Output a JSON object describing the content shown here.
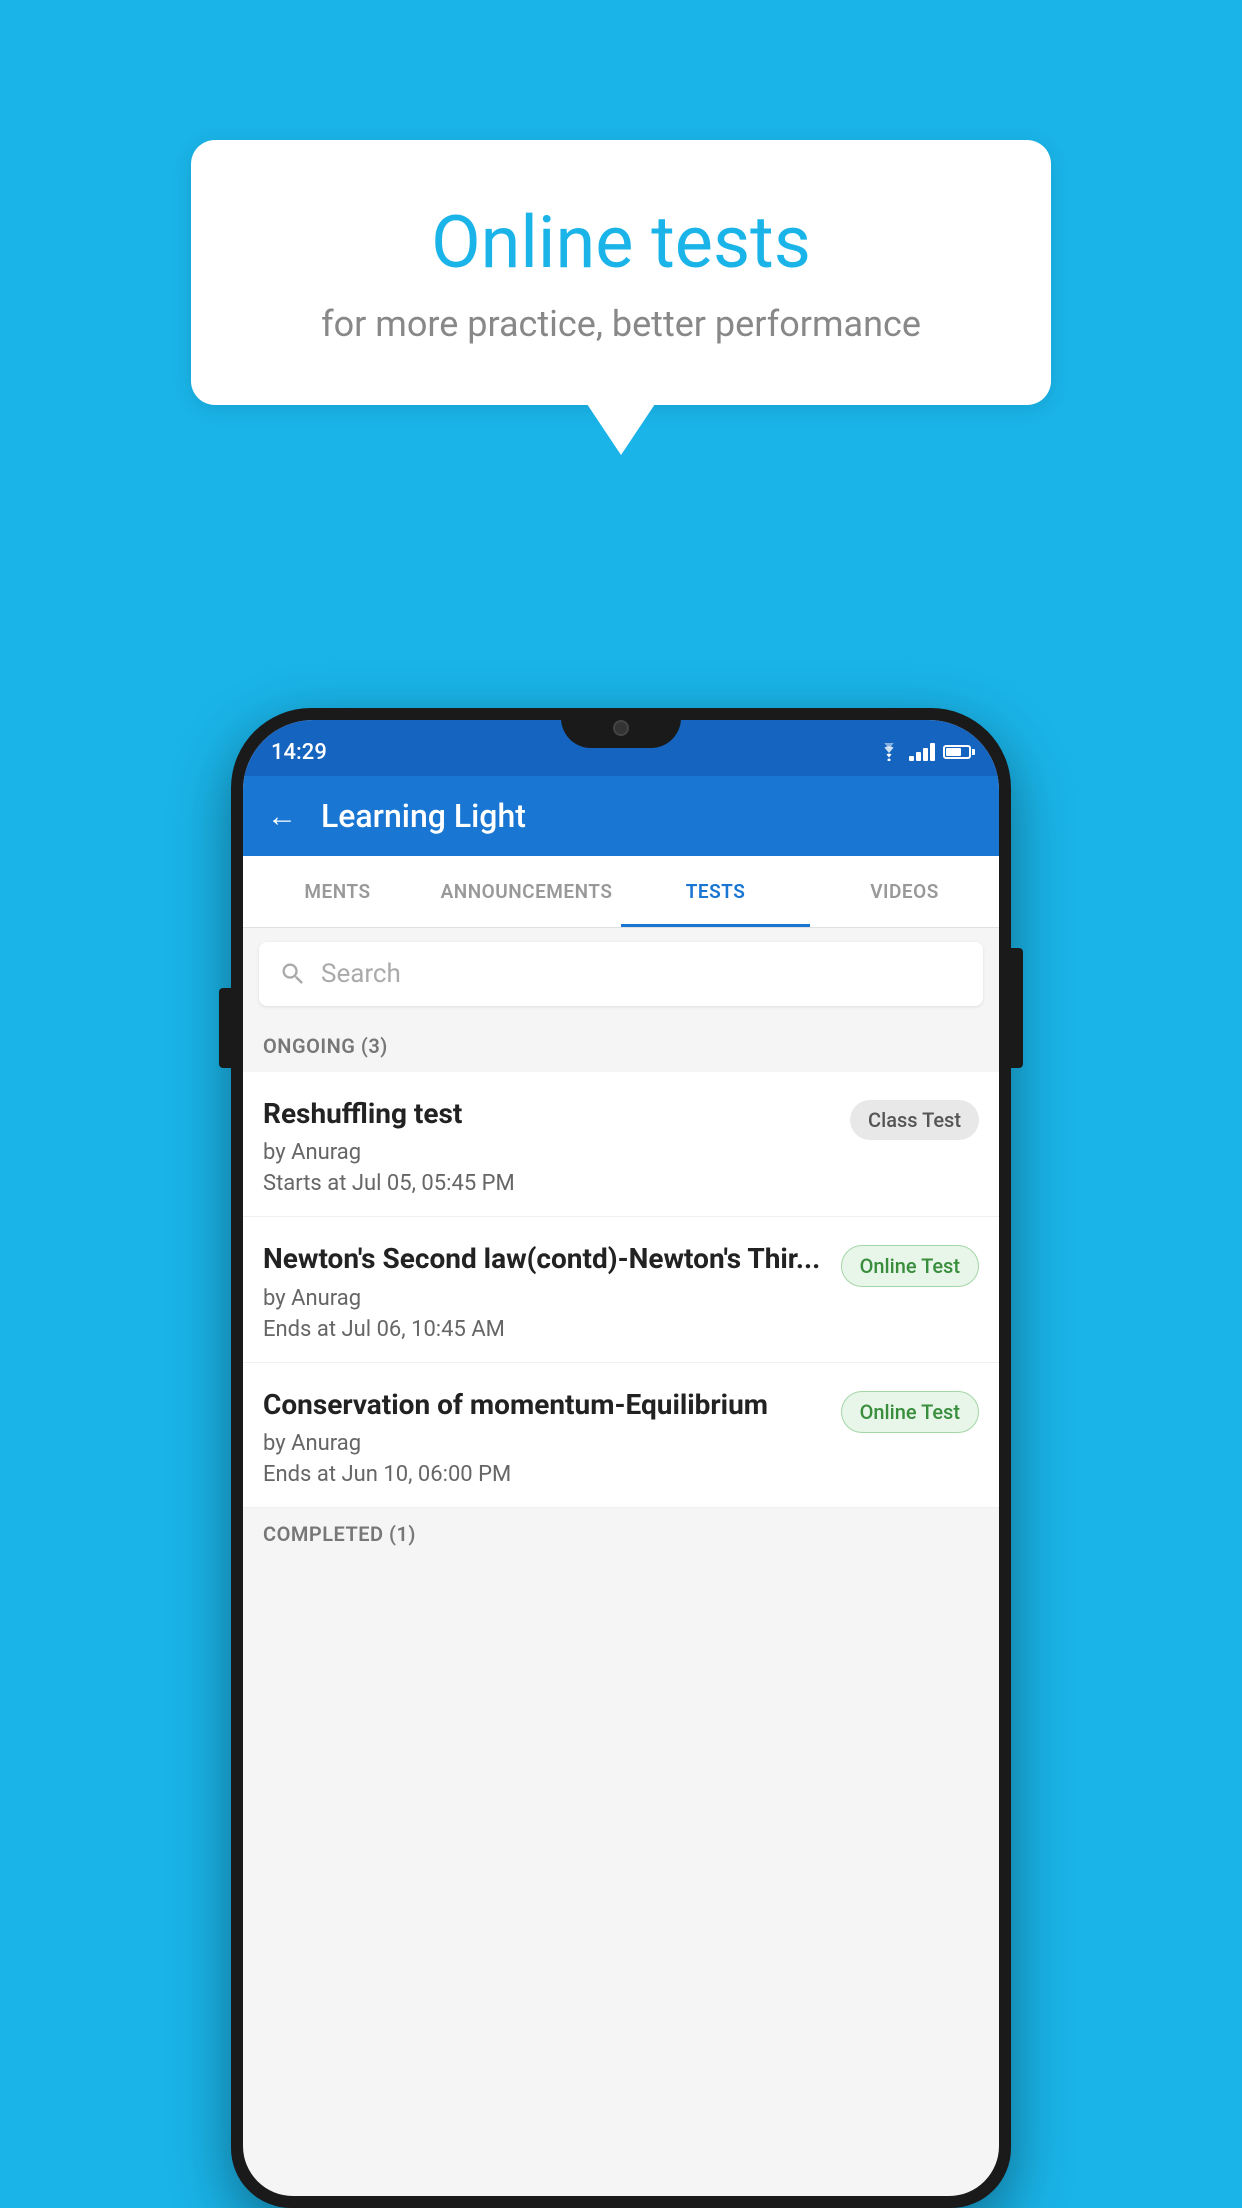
{
  "background_color": "#1ab4e8",
  "speech_bubble": {
    "title": "Online tests",
    "subtitle": "for more practice, better performance"
  },
  "phone": {
    "status_bar": {
      "time": "14:29",
      "wifi": "▼",
      "signal": "▲",
      "battery": "battery"
    },
    "header": {
      "back_label": "←",
      "title": "Learning Light"
    },
    "tabs": [
      {
        "label": "MENTS",
        "active": false
      },
      {
        "label": "ANNOUNCEMENTS",
        "active": false
      },
      {
        "label": "TESTS",
        "active": true
      },
      {
        "label": "VIDEOS",
        "active": false
      }
    ],
    "search": {
      "placeholder": "Search"
    },
    "ongoing_section": {
      "label": "ONGOING (3)"
    },
    "tests": [
      {
        "name": "Reshuffling test",
        "author": "by Anurag",
        "time": "Starts at  Jul 05, 05:45 PM",
        "badge": "Class Test",
        "badge_type": "class"
      },
      {
        "name": "Newton's Second law(contd)-Newton's Thir...",
        "author": "by Anurag",
        "time": "Ends at  Jul 06, 10:45 AM",
        "badge": "Online Test",
        "badge_type": "online"
      },
      {
        "name": "Conservation of momentum-Equilibrium",
        "author": "by Anurag",
        "time": "Ends at  Jun 10, 06:00 PM",
        "badge": "Online Test",
        "badge_type": "online"
      }
    ],
    "completed_section": {
      "label": "COMPLETED (1)"
    }
  }
}
